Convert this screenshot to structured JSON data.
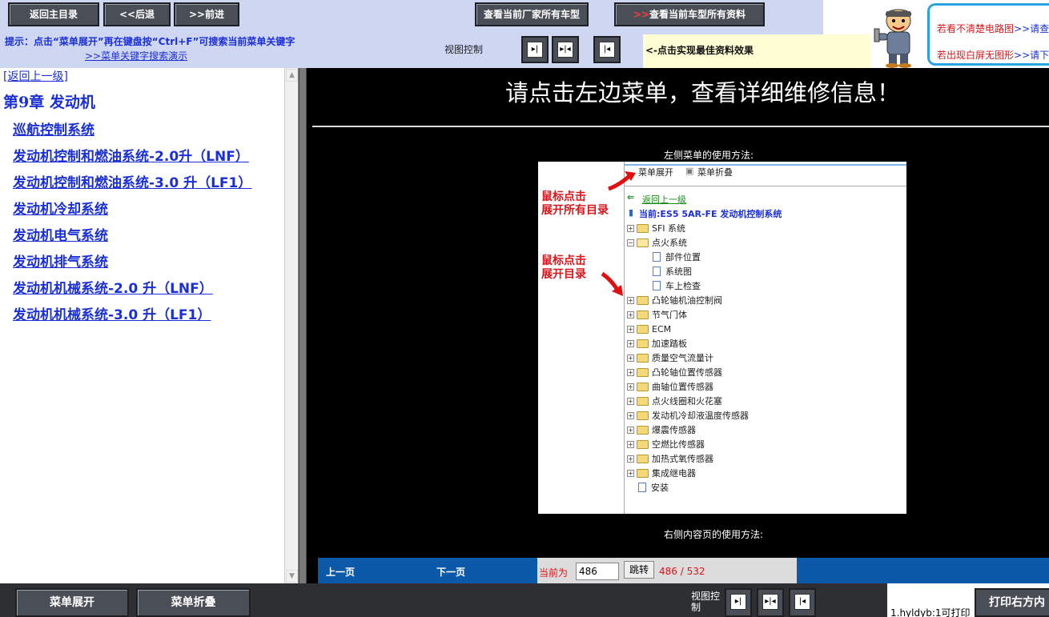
{
  "toolbar": {
    "home": "返回主目录",
    "back": "<<后退",
    "forward": ">>前进",
    "view_models": "查看当前厂家所有车型",
    "view_all": "查看当前车型所有资料",
    "hint": "提示：点击“菜单展开”再在键盘按“Ctrl+F”可搜索当前菜单关键字",
    "hint_link": ">>菜单关键字搜索演示",
    "view_label": "视图控制",
    "tip": "<-点击实现最佳资料效果"
  },
  "notice": {
    "line1": "若看不清楚电路图",
    "line1_link": ">>请查",
    "line2": "若出现白屏无图形",
    "line2_link": ">>请下"
  },
  "left": {
    "back_up": "[返回上一级]",
    "chapter": "第9章 发动机",
    "items": [
      "巡航控制系统",
      "发动机控制和燃油系统-2.0升（LNF）",
      "发动机控制和燃油系统-3.0 升（LF1）",
      "发动机冷却系统",
      "发动机电气系统",
      "发动机排气系统",
      "发动机机械系统-2.0 升（LNF）",
      "发动机机械系统-3.0 升（LF1）"
    ]
  },
  "content": {
    "title": "请点击左边菜单，查看详细维修信息！",
    "left_usage": "左侧菜单的使用方法:",
    "right_usage": "右侧内容页的使用方法:",
    "demo": {
      "expand": "菜单展开",
      "collapse": "菜单折叠",
      "annot1": "鼠标点击\n展开所有目录",
      "annot2": "鼠标点击\n展开目录",
      "back": "返回上一级",
      "current": "当前:ES5 5AR-FE 发动机控制系统",
      "tree": [
        {
          "label": "SFI 系统",
          "type": "folder-closed"
        },
        {
          "label": "点火系统",
          "type": "folder-open"
        },
        {
          "label": "部件位置",
          "type": "page"
        },
        {
          "label": "系统图",
          "type": "page"
        },
        {
          "label": "车上检查",
          "type": "page"
        },
        {
          "label": "凸轮轴机油控制阀",
          "type": "folder-closed"
        },
        {
          "label": "节气门体",
          "type": "folder-closed"
        },
        {
          "label": "ECM",
          "type": "folder-closed"
        },
        {
          "label": "加速踏板",
          "type": "folder-closed"
        },
        {
          "label": "质量空气流量计",
          "type": "folder-closed"
        },
        {
          "label": "凸轮轴位置传感器",
          "type": "folder-closed"
        },
        {
          "label": "曲轴位置传感器",
          "type": "folder-closed"
        },
        {
          "label": "点火线圈和火花塞",
          "type": "folder-closed"
        },
        {
          "label": "发动机冷却液温度传感器",
          "type": "folder-closed"
        },
        {
          "label": "爆震传感器",
          "type": "folder-closed"
        },
        {
          "label": "空燃比传感器",
          "type": "folder-closed"
        },
        {
          "label": "加热式氧传感器",
          "type": "folder-closed"
        },
        {
          "label": "集成继电器",
          "type": "folder-closed"
        },
        {
          "label": "安装",
          "type": "page-root"
        }
      ]
    }
  },
  "pager": {
    "prev": "上一页",
    "next": "下一页",
    "current_label": "当前为",
    "current_value": "486",
    "jump": "跳转",
    "count": "486 / 532"
  },
  "bottom": {
    "expand": "菜单展开",
    "collapse": "菜单折叠",
    "view_label": "视图控制",
    "print_note": "1.hyldyb:1可打印",
    "print": "打印右方内"
  },
  "colors": {
    "link_blue": "#1a2fd8",
    "alert_red": "#d8161b",
    "pager_blue": "#0b59a8"
  }
}
